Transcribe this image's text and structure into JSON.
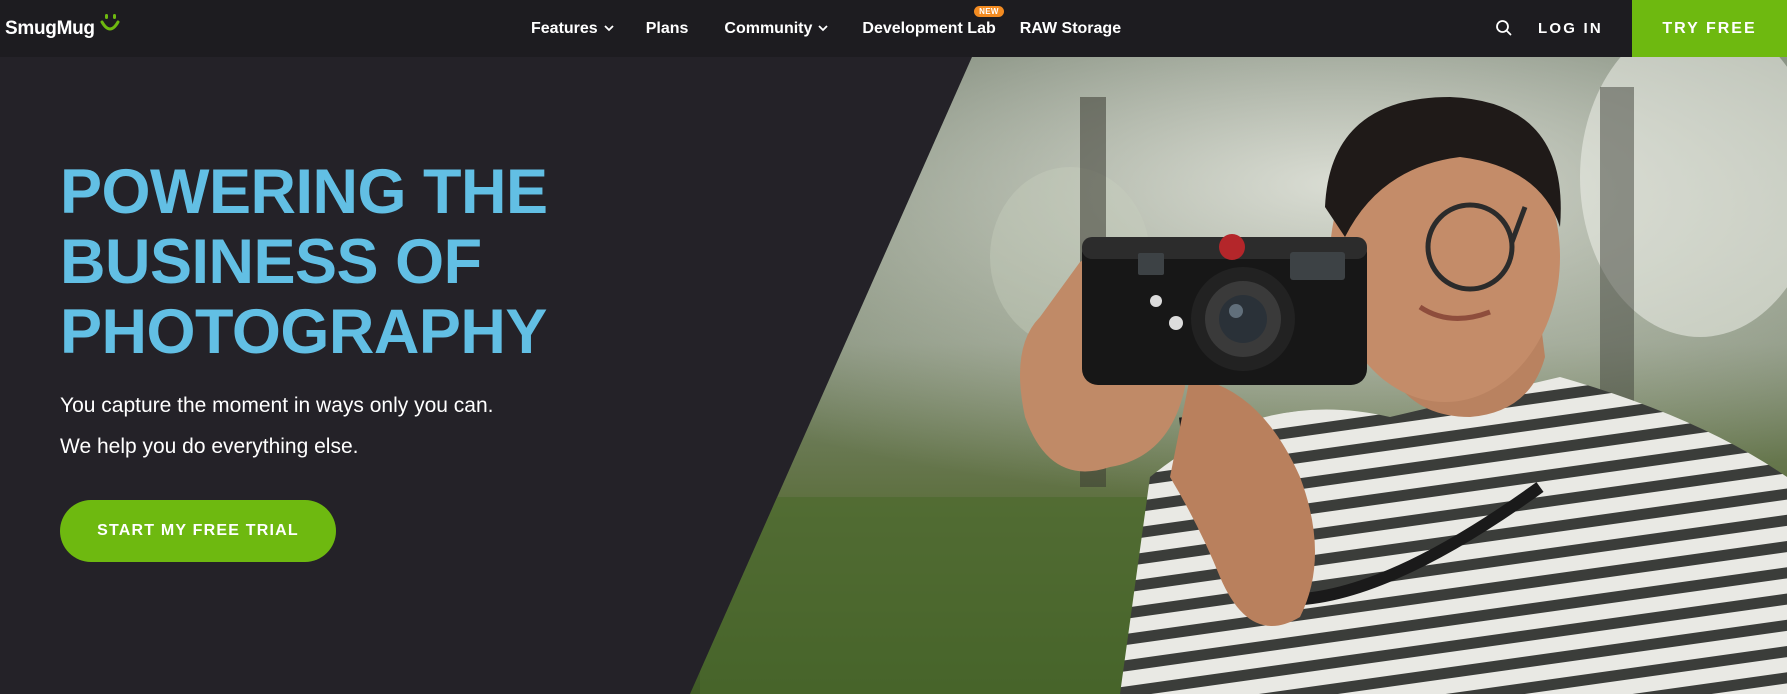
{
  "header": {
    "logo_text": "SmugMug",
    "nav": [
      {
        "label": "Features",
        "has_dropdown": true
      },
      {
        "label": "Plans",
        "has_dropdown": false
      },
      {
        "label": "Community",
        "has_dropdown": true
      },
      {
        "label": "Development Lab",
        "has_dropdown": false,
        "badge": "NEW"
      },
      {
        "label": "RAW Storage",
        "has_dropdown": false
      }
    ],
    "search_icon": "search-icon",
    "login_label": "LOG IN",
    "try_free_label": "TRY FREE"
  },
  "hero": {
    "title_lines": [
      "POWERING THE",
      "BUSINESS OF",
      "PHOTOGRAPHY"
    ],
    "subtitle": "You capture the moment in ways only you can. We help you do everything else.",
    "cta_label": "START MY FREE TRIAL",
    "photo_icon": "photographer-with-camera-image"
  },
  "colors": {
    "background": "#242228",
    "header": "#1d1c20",
    "accent_green": "#6eb910",
    "title_blue": "#62bfe4",
    "badge_orange": "#f38b21"
  }
}
